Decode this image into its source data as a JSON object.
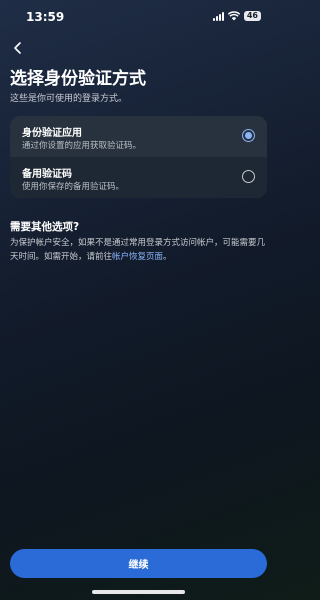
{
  "status_bar": {
    "time": "13:59",
    "battery": "46",
    "icons": [
      "signal-icon",
      "wifi-icon",
      "battery-icon"
    ]
  },
  "header": {
    "back_icon": "chevron-left-icon",
    "title": "选择身份验证方式",
    "subtitle": "这些是你可使用的登录方式。"
  },
  "options": [
    {
      "title": "身份验证应用",
      "description": "通过你设置的应用获取验证码。",
      "selected": true
    },
    {
      "title": "备用验证码",
      "description": "使用你保存的备用验证码。",
      "selected": false
    }
  ],
  "help": {
    "heading": "需要其他选项?",
    "text": "为保护帐户安全，如果不是通过常用登录方式访问帐户，可能需要几天时间。如需开始，请前往",
    "link": "帐户恢复页面",
    "end": "。"
  },
  "continue_label": "继续",
  "colors": {
    "accent": "#8ab4f8",
    "button": "#2a6bd8",
    "card": "#1e2834",
    "selected_row": "#28323e"
  }
}
